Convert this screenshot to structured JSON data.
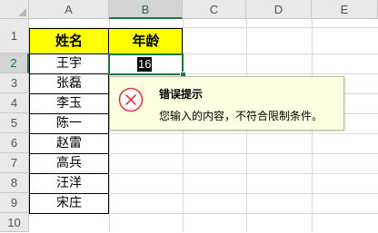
{
  "sheet": {
    "columns": [
      "A",
      "B",
      "C",
      "D",
      "E"
    ],
    "rows": [
      "1",
      "2",
      "3",
      "4",
      "5",
      "6",
      "7",
      "8",
      "9",
      "10"
    ],
    "header": {
      "name": "姓名",
      "age": "年龄"
    },
    "names": [
      "王宇",
      "张磊",
      "李玉",
      "陈一",
      "赵雷",
      "高兵",
      "汪洋",
      "宋庄"
    ],
    "active_cell_value": "16"
  },
  "error_tip": {
    "title": "错误提示",
    "message": "您输入的内容，不符合限制条件。",
    "icon": "error-x-icon"
  },
  "colors": {
    "header_fill": "#ffff00",
    "selection": "#217346",
    "tip_bg": "#ffffe1",
    "error_red": "#e0393e"
  }
}
